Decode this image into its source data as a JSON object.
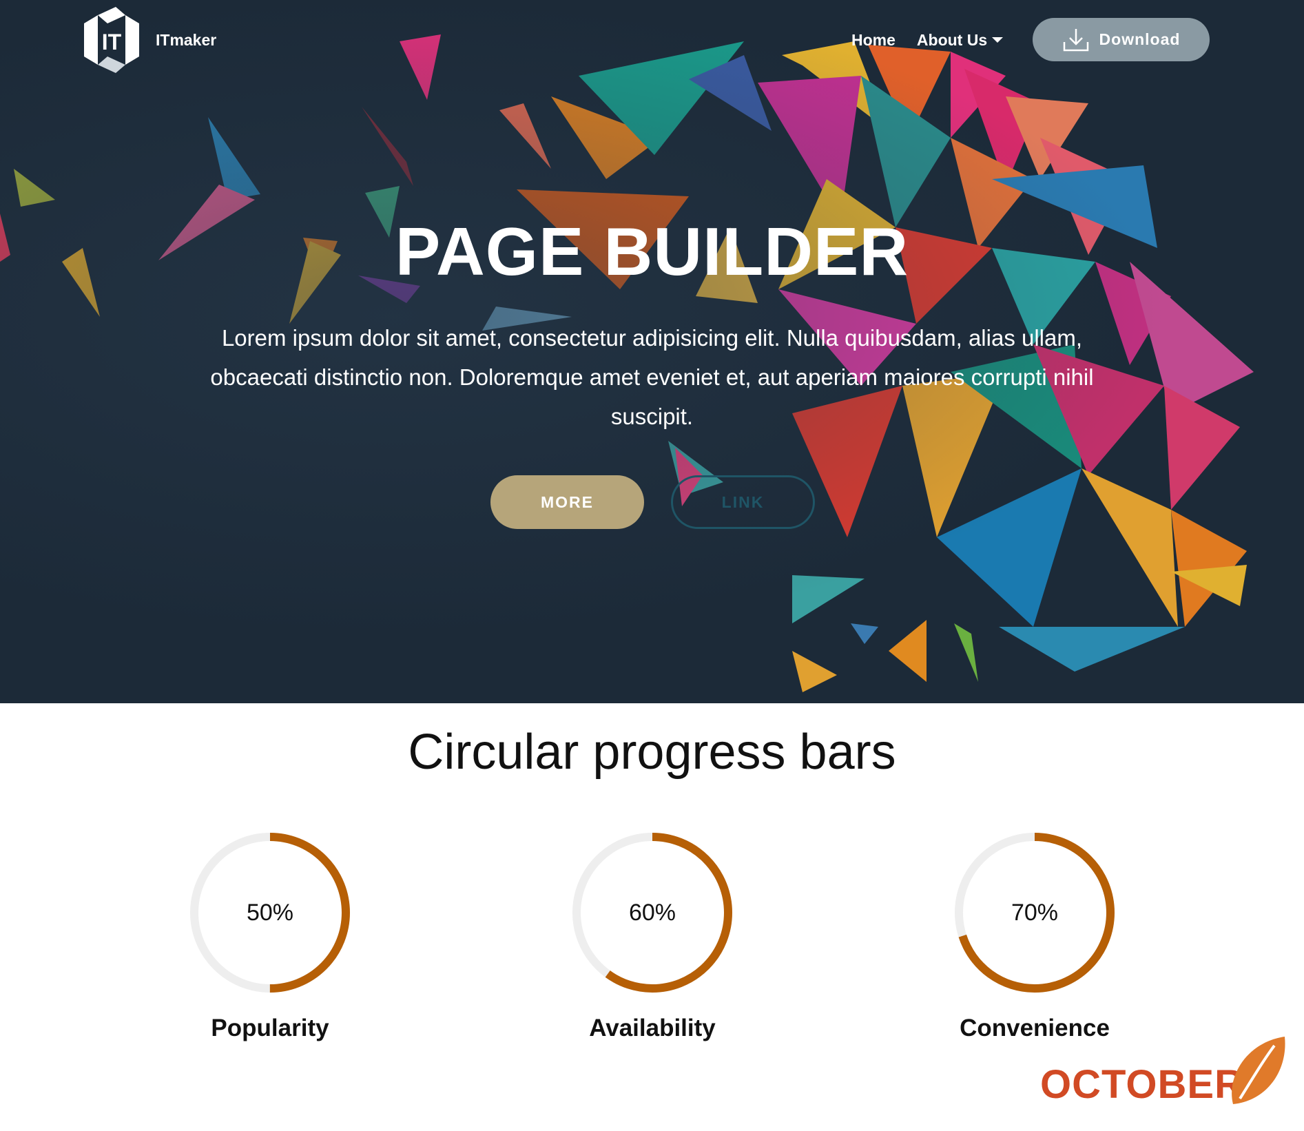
{
  "header": {
    "brand": "ITmaker",
    "logo_text": "IT",
    "nav": {
      "home": "Home",
      "about": "About Us"
    },
    "download_label": "Download"
  },
  "hero": {
    "title": "PAGE BUILDER",
    "text": "Lorem ipsum dolor sit amet, consectetur adipisicing elit. Nulla quibusdam, alias ullam, obcaecati distinctio non. Doloremque amet eveniet et, aut aperiam maiores corrupti nihil suscipit.",
    "buttons": {
      "more": "MORE",
      "link": "LINK"
    }
  },
  "progress_section": {
    "title": "Circular progress bars",
    "items": [
      {
        "value_label": "50%",
        "value": 0.5,
        "label": "Popularity"
      },
      {
        "value_label": "60%",
        "value": 0.6,
        "label": "Availability"
      },
      {
        "value_label": "70%",
        "value": 0.7,
        "label": "Convenience"
      }
    ]
  },
  "watermark": {
    "text": "OCTOBER"
  },
  "colors": {
    "hero_bg": "#1c2a38",
    "accent_progress": "#b65f06",
    "track": "#eeeeee",
    "more_button": "#b6a57a",
    "download_button": "#8a9aa3",
    "link_outline": "#1f5566",
    "watermark": "#d14a24"
  },
  "icons": {
    "logo": "it-logo-icon",
    "download": "download-icon",
    "caret": "caret-down-icon",
    "watermark": "leaf-icon"
  }
}
